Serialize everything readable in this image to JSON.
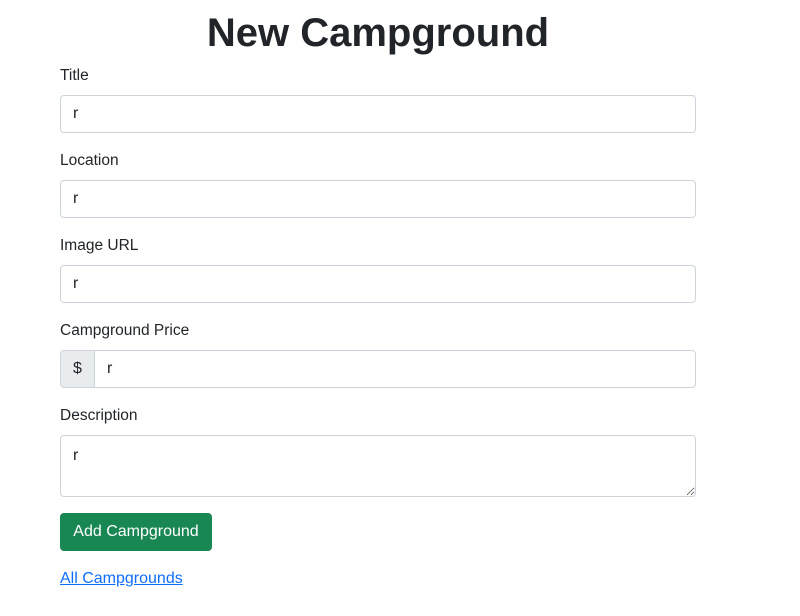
{
  "page": {
    "title": "New Campground"
  },
  "form": {
    "title": {
      "label": "Title",
      "value": "r"
    },
    "location": {
      "label": "Location",
      "value": "r"
    },
    "image": {
      "label": "Image URL",
      "value": "r"
    },
    "price": {
      "label": "Campground Price",
      "prefix": "$",
      "value": "r"
    },
    "description": {
      "label": "Description",
      "value": "r"
    },
    "submit_label": "Add Campground"
  },
  "links": {
    "all": "All Campgrounds"
  },
  "colors": {
    "primary_button": "#198754",
    "link": "#0d6efd"
  }
}
